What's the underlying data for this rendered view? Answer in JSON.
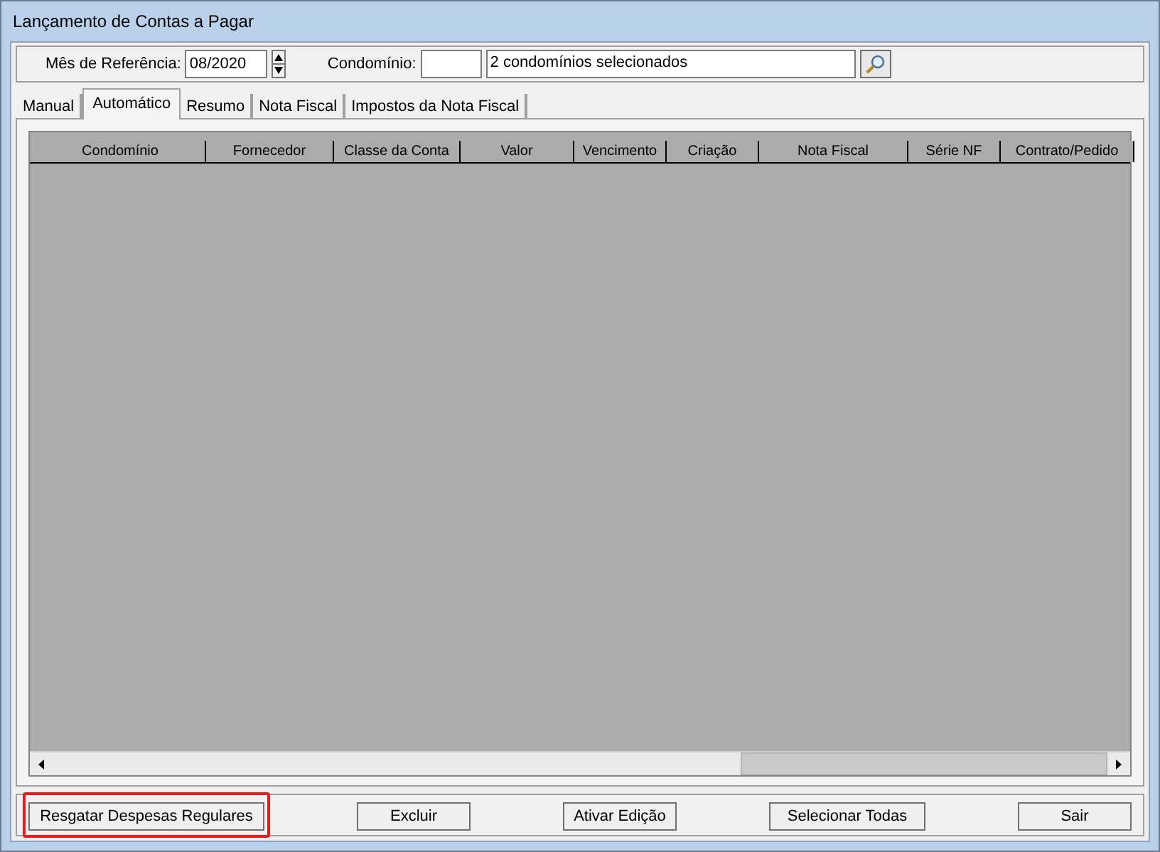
{
  "window": {
    "title": "Lançamento de Contas a Pagar"
  },
  "filters": {
    "month_label": "Mês de Referência:",
    "month_value": "08/2020",
    "condo_label": "Condomínio:",
    "condo_selection": "2 condomínios selecionados"
  },
  "tabs": [
    {
      "label": "Manual",
      "selected": false
    },
    {
      "label": "Automático",
      "selected": true
    },
    {
      "label": "Resumo",
      "selected": false
    },
    {
      "label": "Nota Fiscal",
      "selected": false
    },
    {
      "label": "Impostos da Nota Fiscal",
      "selected": false
    }
  ],
  "table": {
    "columns": [
      "Condomínio",
      "Fornecedor",
      "Classe da Conta",
      "Valor",
      "Vencimento",
      "Criação",
      "Nota Fiscal",
      "Série NF",
      "Contrato/Pedido"
    ]
  },
  "buttons": [
    {
      "label": "Resgatar Despesas Regulares",
      "highlighted": true
    },
    {
      "label": "Excluir",
      "highlighted": false
    },
    {
      "label": "Ativar Edição",
      "highlighted": false
    },
    {
      "label": "Selecionar Todas",
      "highlighted": false
    },
    {
      "label": "Sair",
      "highlighted": false
    }
  ]
}
